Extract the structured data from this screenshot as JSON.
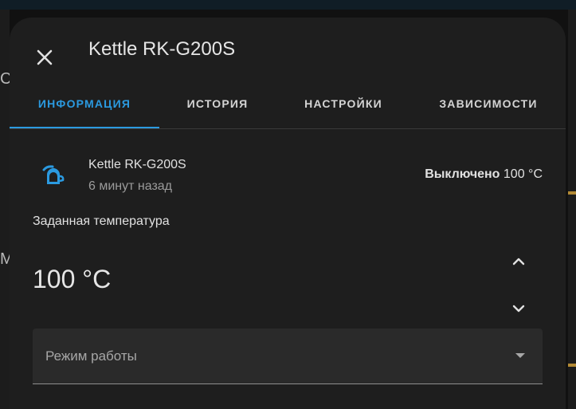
{
  "dialog": {
    "title": "Kettle RK-G200S"
  },
  "tabs": [
    {
      "label": "ИНФОРМАЦИЯ",
      "active": true
    },
    {
      "label": "ИСТОРИЯ",
      "active": false
    },
    {
      "label": "НАСТРОЙКИ",
      "active": false
    },
    {
      "label": "ЗАВИСИМОСТИ",
      "active": false
    }
  ],
  "entity": {
    "name": "Kettle RK-G200S",
    "last_changed": "6 минут назад",
    "state": "Выключено",
    "current_temperature": "100 °C",
    "icon": "kettle-icon",
    "icon_color": "#2b9ae0"
  },
  "target": {
    "label": "Заданная температура",
    "value": "100 °C"
  },
  "mode_select": {
    "label": "Режим работы"
  },
  "background": {
    "letter_1": "С",
    "letter_2": "М"
  },
  "colors": {
    "accent": "#2b9ae0",
    "dialog_bg": "#1e1e1e"
  }
}
